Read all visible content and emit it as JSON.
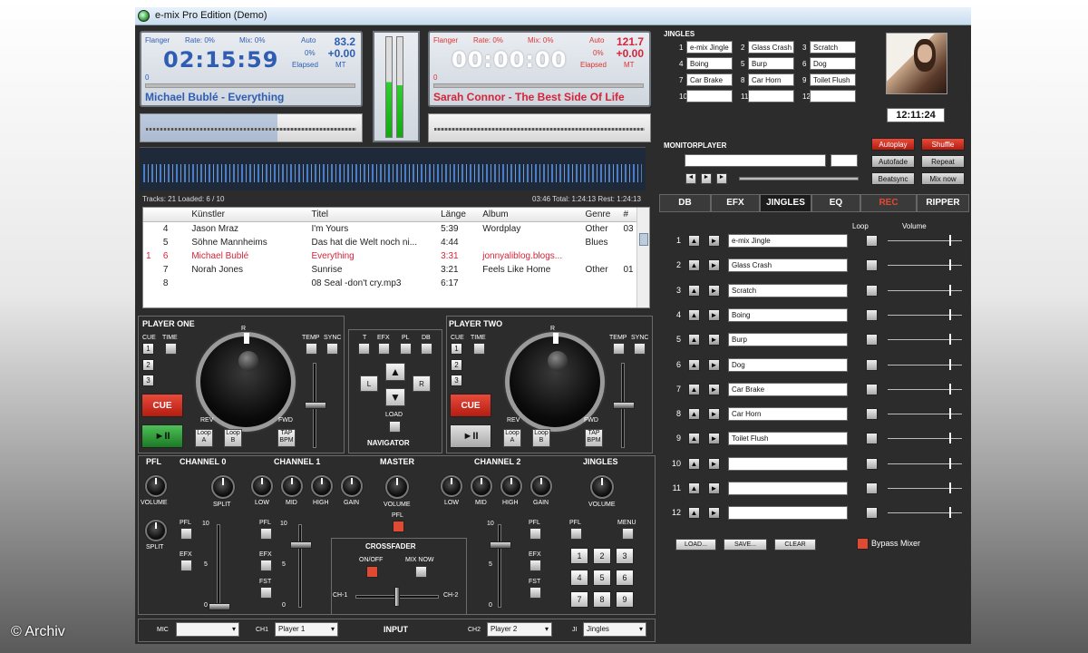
{
  "window": {
    "title": "e-mix Pro Edition (Demo)"
  },
  "watermark": "© Archiv",
  "deck1": {
    "flanger": "Flanger",
    "rate": "Rate: 0%",
    "mix": "Mix: 0%",
    "auto": "Auto",
    "bpm": "83.2",
    "pitch": "+0.00",
    "pct": "0%",
    "elapsed": "Elapsed",
    "mt": "MT",
    "time": "02:15:59",
    "song": "Michael Bublé - Everything",
    "progress_label": "0",
    "color": "#2f5db3"
  },
  "deck2": {
    "flanger": "Flanger",
    "rate": "Rate: 0%",
    "mix": "Mix: 0%",
    "auto": "Auto",
    "bpm": "121.7",
    "pitch": "+0.00",
    "pct": "0%",
    "elapsed": "Elapsed",
    "mt": "MT",
    "time": "00:00:00",
    "song": "Sarah Connor - The Best Side Of Life",
    "progress_label": "0",
    "color": "#d6243a"
  },
  "status": {
    "left": "Tracks: 21 Loaded: 6 / 10",
    "right": "03:46 Total: 1:24:13 Rest: 1:24:13"
  },
  "playlist": {
    "columns": [
      "",
      "",
      "Künstler",
      "Titel",
      "Länge",
      "Album",
      "Genre",
      "#"
    ],
    "rows": [
      [
        "",
        "4",
        "Jason Mraz",
        "I'm Yours",
        "5:39",
        "Wordplay",
        "Other",
        "03"
      ],
      [
        "",
        "5",
        "Söhne Mannheims",
        "Das hat die Welt noch ni...",
        "4:44",
        "",
        "Blues",
        ""
      ],
      [
        "1",
        "6",
        "Michael Bublé",
        "Everything",
        "3:31",
        "jonnyaliblog.blogs...",
        "",
        ""
      ],
      [
        "",
        "7",
        "Norah Jones",
        "Sunrise",
        "3:21",
        "Feels Like Home",
        "Other",
        "01"
      ],
      [
        "",
        "8",
        "",
        "08 Seal -don't cry.mp3",
        "6:17",
        "",
        "",
        ""
      ]
    ],
    "highlight_row": 2,
    "highlight_color": "#d6243a"
  },
  "jingles_top": {
    "title": "JINGLES",
    "items": [
      {
        "n": "1",
        "label": "e-mix Jingle"
      },
      {
        "n": "2",
        "label": "Glass Crash"
      },
      {
        "n": "3",
        "label": "Scratch"
      },
      {
        "n": "4",
        "label": "Boing"
      },
      {
        "n": "5",
        "label": "Burp"
      },
      {
        "n": "6",
        "label": "Dog"
      },
      {
        "n": "7",
        "label": "Car Brake"
      },
      {
        "n": "8",
        "label": "Car Horn"
      },
      {
        "n": "9",
        "label": "Toilet Flush"
      },
      {
        "n": "10",
        "label": ""
      },
      {
        "n": "11",
        "label": ""
      },
      {
        "n": "12",
        "label": ""
      }
    ]
  },
  "clock": "12:11:24",
  "monitor": {
    "title": "MONITORPLAYER"
  },
  "options": [
    {
      "label": "Autoplay",
      "active": true
    },
    {
      "label": "Shuffle",
      "active": true
    },
    {
      "label": "Autofade",
      "active": false
    },
    {
      "label": "Repeat",
      "active": false
    },
    {
      "label": "Beatsync",
      "active": false
    },
    {
      "label": "Mix now",
      "active": false
    }
  ],
  "tabs": [
    {
      "label": "DB",
      "active": false
    },
    {
      "label": "EFX",
      "active": false
    },
    {
      "label": "JINGLES",
      "active": true
    },
    {
      "label": "EQ",
      "active": false
    },
    {
      "label": "REC",
      "active": false
    },
    {
      "label": "RIPPER",
      "active": false
    }
  ],
  "jingle_panel": {
    "loop_label": "Loop",
    "volume_label": "Volume",
    "rows": [
      {
        "n": "1",
        "label": "e-mix Jingle"
      },
      {
        "n": "2",
        "label": "Glass Crash"
      },
      {
        "n": "3",
        "label": "Scratch"
      },
      {
        "n": "4",
        "label": "Boing"
      },
      {
        "n": "5",
        "label": "Burp"
      },
      {
        "n": "6",
        "label": "Dog"
      },
      {
        "n": "7",
        "label": "Car Brake"
      },
      {
        "n": "8",
        "label": "Car Horn"
      },
      {
        "n": "9",
        "label": "Toilet Flush"
      },
      {
        "n": "10",
        "label": ""
      },
      {
        "n": "11",
        "label": ""
      },
      {
        "n": "12",
        "label": ""
      }
    ],
    "load": "LOAD...",
    "save": "SAVE...",
    "clear": "CLEAR",
    "bypass": "Bypass Mixer"
  },
  "player1": {
    "title": "PLAYER ONE",
    "cue": "CUE",
    "time": "TIME",
    "temp": "TEMP",
    "sync": "SYNC",
    "rev": "REV",
    "fwd": "FWD",
    "cue_btn": "CUE",
    "play": "►II",
    "loop_a": "Loop A",
    "loop_b": "Loop B",
    "tap": "TAP BPM",
    "r": "R",
    "nums": [
      "1",
      "2",
      "3"
    ]
  },
  "player2": {
    "title": "PLAYER TWO",
    "cue": "CUE",
    "time": "TIME",
    "temp": "TEMP",
    "sync": "SYNC",
    "rev": "REV",
    "fwd": "FWD",
    "cue_btn": "CUE",
    "play": "►II",
    "loop_a": "Loop A",
    "loop_b": "Loop B",
    "tap": "TAP BPM",
    "r": "R",
    "nums": [
      "1",
      "2",
      "3"
    ]
  },
  "navigator": {
    "title": "NAVIGATOR",
    "t": "T",
    "efx": "EFX",
    "pl": "PL",
    "db": "DB",
    "l": "L",
    "r": "R",
    "load": "LOAD"
  },
  "mixer": {
    "pfl": "PFL",
    "volume": "VOLUME",
    "split": "SPLIT",
    "ch0": "CHANNEL 0",
    "ch1": "CHANNEL 1",
    "master": "MASTER",
    "ch2": "CHANNEL 2",
    "jingles": "JINGLES",
    "low": "LOW",
    "mid": "MID",
    "high": "HIGH",
    "gain": "GAIN",
    "efx": "EFX",
    "fst": "FST",
    "menu": "MENU",
    "crossfader": "CROSSFADER",
    "onoff": "ON/OFF",
    "mixnow": "MIX NOW",
    "chl": "CH-1",
    "chr": "CH-2",
    "s10": "10",
    "s5": "5",
    "s0": "0",
    "pads": [
      "1",
      "2",
      "3",
      "4",
      "5",
      "6",
      "7",
      "8",
      "9"
    ]
  },
  "bottom": {
    "mic": "MIC",
    "ch1": "CH1",
    "ch1_val": "Player 1",
    "input": "INPUT",
    "ch2": "CH2",
    "ch2_val": "Player 2",
    "ji": "JI",
    "ji_val": "Jingles"
  }
}
